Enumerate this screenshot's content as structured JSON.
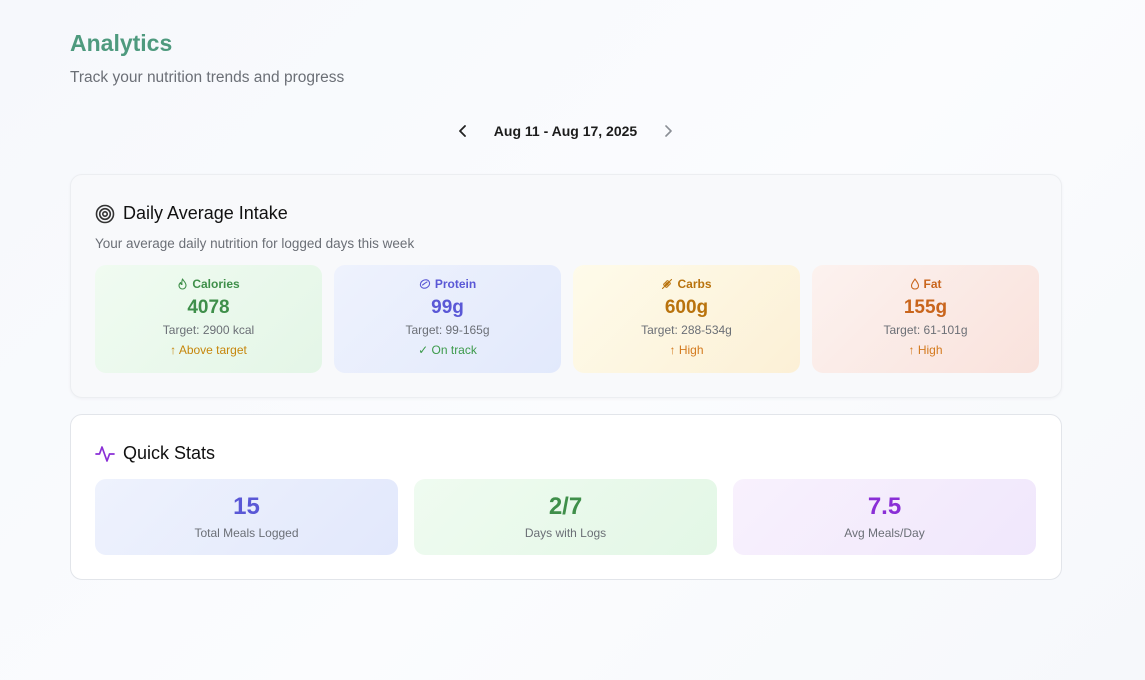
{
  "header": {
    "title": "Analytics",
    "subtitle": "Track your nutrition trends and progress"
  },
  "date_nav": {
    "range_label": "Aug 11 - Aug 17, 2025",
    "prev_icon": "chevron-left-icon",
    "next_icon": "chevron-right-icon"
  },
  "intake": {
    "title": "Daily Average Intake",
    "description": "Your average daily nutrition for logged days this week",
    "icon": "target-icon",
    "macros": [
      {
        "label": "Calories",
        "value": "4078",
        "target": "Target: 2900 kcal",
        "status": "↑ Above target",
        "icon": "flame-icon",
        "color": "#3f8f4a"
      },
      {
        "label": "Protein",
        "value": "99g",
        "target": "Target: 99-165g",
        "status": "✓ On track",
        "icon": "protein-icon",
        "color": "#5a58d6"
      },
      {
        "label": "Carbs",
        "value": "600g",
        "target": "Target: 288-534g",
        "status": "↑ High",
        "icon": "wheat-icon",
        "color": "#b9730d"
      },
      {
        "label": "Fat",
        "value": "155g",
        "target": "Target: 61-101g",
        "status": "↑ High",
        "icon": "droplet-icon",
        "color": "#c9651c"
      }
    ]
  },
  "quick_stats": {
    "title": "Quick Stats",
    "icon": "activity-icon",
    "items": [
      {
        "value": "15",
        "label": "Total Meals Logged",
        "color": "#5a58d6"
      },
      {
        "value": "2/7",
        "label": "Days with Logs",
        "color": "#3f8f4a"
      },
      {
        "value": "7.5",
        "label": "Avg Meals/Day",
        "color": "#8a2fd6"
      }
    ]
  }
}
